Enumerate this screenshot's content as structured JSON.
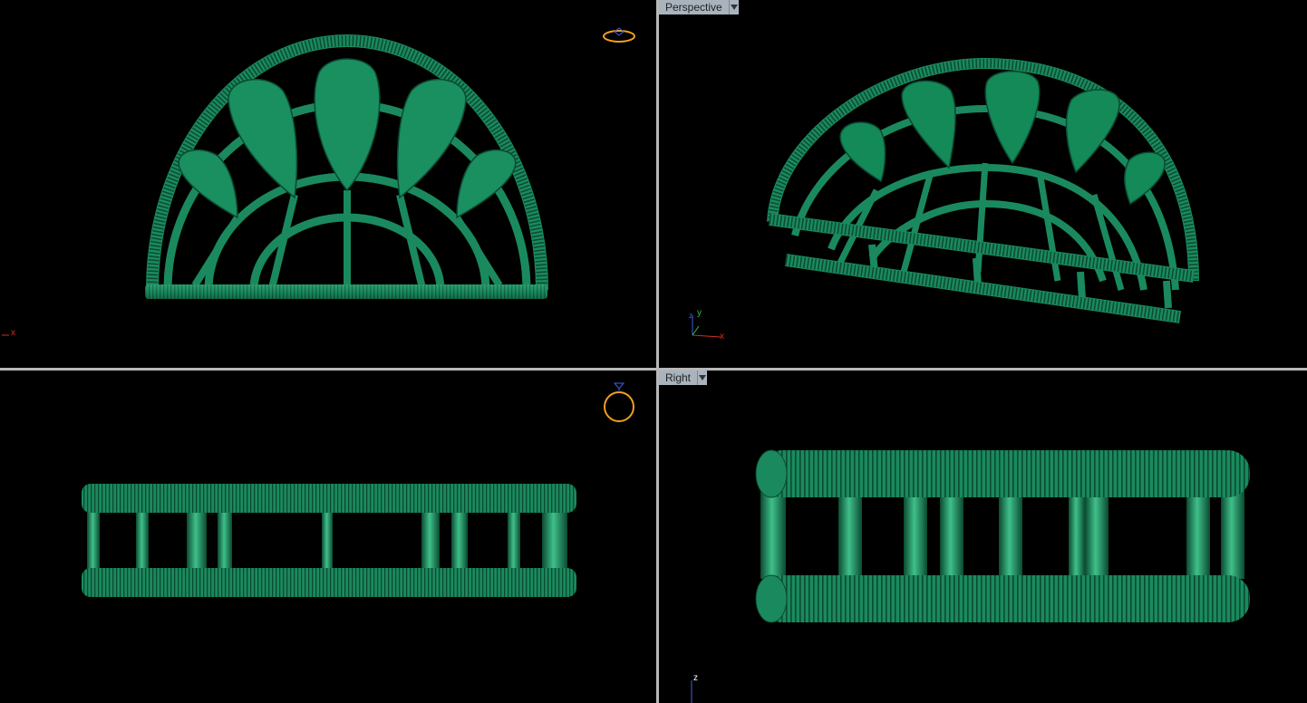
{
  "viewports": {
    "top": {
      "axis_x": "x"
    },
    "perspective": {
      "tab_label": "Perspective",
      "axis_x": "x",
      "axis_y": "y",
      "axis_z": "z"
    },
    "front": {},
    "right": {
      "tab_label": "Right",
      "axis_z": "z"
    }
  },
  "colors": {
    "model": "#1a8a5e",
    "model_dark": "#0f5c3d",
    "model_light": "#3fc08a",
    "axis_x": "#d03020",
    "axis_y": "#30c040",
    "axis_z": "#4060e0",
    "gumball": "#f0a020"
  },
  "icons": {
    "ring_gumball": "ring-icon",
    "dropdown": "chevron-down-icon"
  }
}
